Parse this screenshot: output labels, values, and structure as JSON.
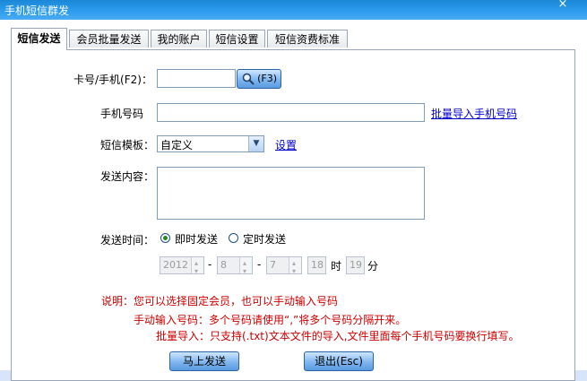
{
  "window": {
    "title": "手机短信群发",
    "close_label": "×"
  },
  "tabs": [
    {
      "label": "短信发送"
    },
    {
      "label": "会员批量发送"
    },
    {
      "label": "我的账户"
    },
    {
      "label": "短信设置"
    },
    {
      "label": "短信资费标准"
    }
  ],
  "form": {
    "card_label": "卡号/手机(F2)：",
    "card_value": "",
    "search_button": "(F3)",
    "phone_label": "手机号码",
    "phone_value": "",
    "import_link": "批量导入手机号码",
    "template_label": "短信模板：",
    "template_value": "自定义",
    "settings_link": "设置",
    "content_label": "发送内容：",
    "content_value": "",
    "time_label": "发送时间：",
    "radio_now": "即时发送",
    "radio_timed": "定时发送",
    "year": "2012",
    "month": "8",
    "day": "7",
    "hour": "18",
    "hour_unit": "时",
    "minute": "19",
    "minute_unit": "分",
    "dash": "-"
  },
  "notes": {
    "line1": "说明：您可以选择固定会员，也可以手动输入号码",
    "line2": "手动输入号码：多个号码请使用“,”将多个号码分隔开来。",
    "line3": "批量导入：只支持(.txt)文本文件的导入,文件里面每个手机号码要换行填写。"
  },
  "buttons": {
    "send": "马上发送",
    "exit": "退出(Esc)"
  }
}
